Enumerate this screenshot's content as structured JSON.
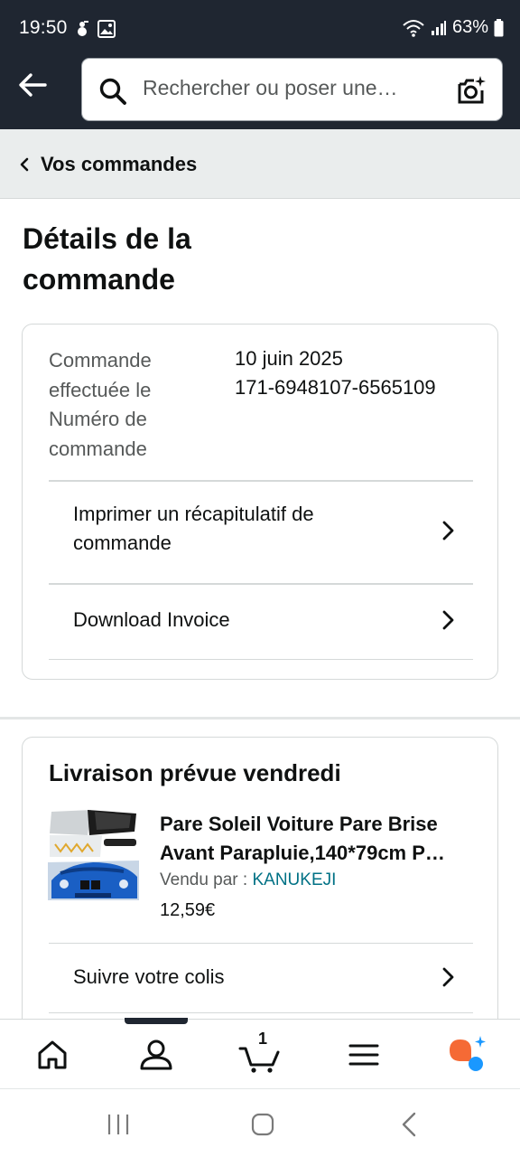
{
  "status_bar": {
    "time": "19:50",
    "battery": "63%",
    "icons": [
      "notification-icon",
      "gallery-icon",
      "wifi-icon",
      "signal-icon",
      "battery-icon"
    ]
  },
  "header": {
    "search_placeholder": "Rechercher ou poser une…",
    "icons": [
      "back-arrow-icon",
      "search-icon",
      "camera-search-icon"
    ]
  },
  "breadcrumb": {
    "label": "Vos commandes"
  },
  "page": {
    "title": "Détails de la commande"
  },
  "order": {
    "placed_label": "Commande effectuée le",
    "number_label": "Numéro de commande",
    "placed_value": "10 juin 2025",
    "number_value": "171-6948107-6565109",
    "actions": [
      {
        "label": "Imprimer un récapitulatif de commande"
      },
      {
        "label": "Download Invoice"
      }
    ]
  },
  "shipment": {
    "title": "Livraison prévue vendredi",
    "product_title": "Pare Soleil Voiture Pare Brise Avant Parapluie,140*79cm P…",
    "sold_by_label": "Vendu par  :",
    "seller": "KANUKEJI",
    "price": "12,59€",
    "track_label": "Suivre votre colis"
  },
  "bottom_nav": {
    "cart_count": "1",
    "items": [
      "home-icon",
      "account-icon",
      "cart-icon",
      "menu-icon",
      "assistant-icon"
    ]
  },
  "system_nav": {
    "items": [
      "recents-icon",
      "home-button-icon",
      "back-icon"
    ]
  },
  "colors": {
    "header_bg": "#1f2631",
    "breadcrumb_bg": "#eaeded",
    "link": "#007185",
    "assistant_orange": "#f56a35",
    "assistant_blue": "#1a98ff"
  }
}
